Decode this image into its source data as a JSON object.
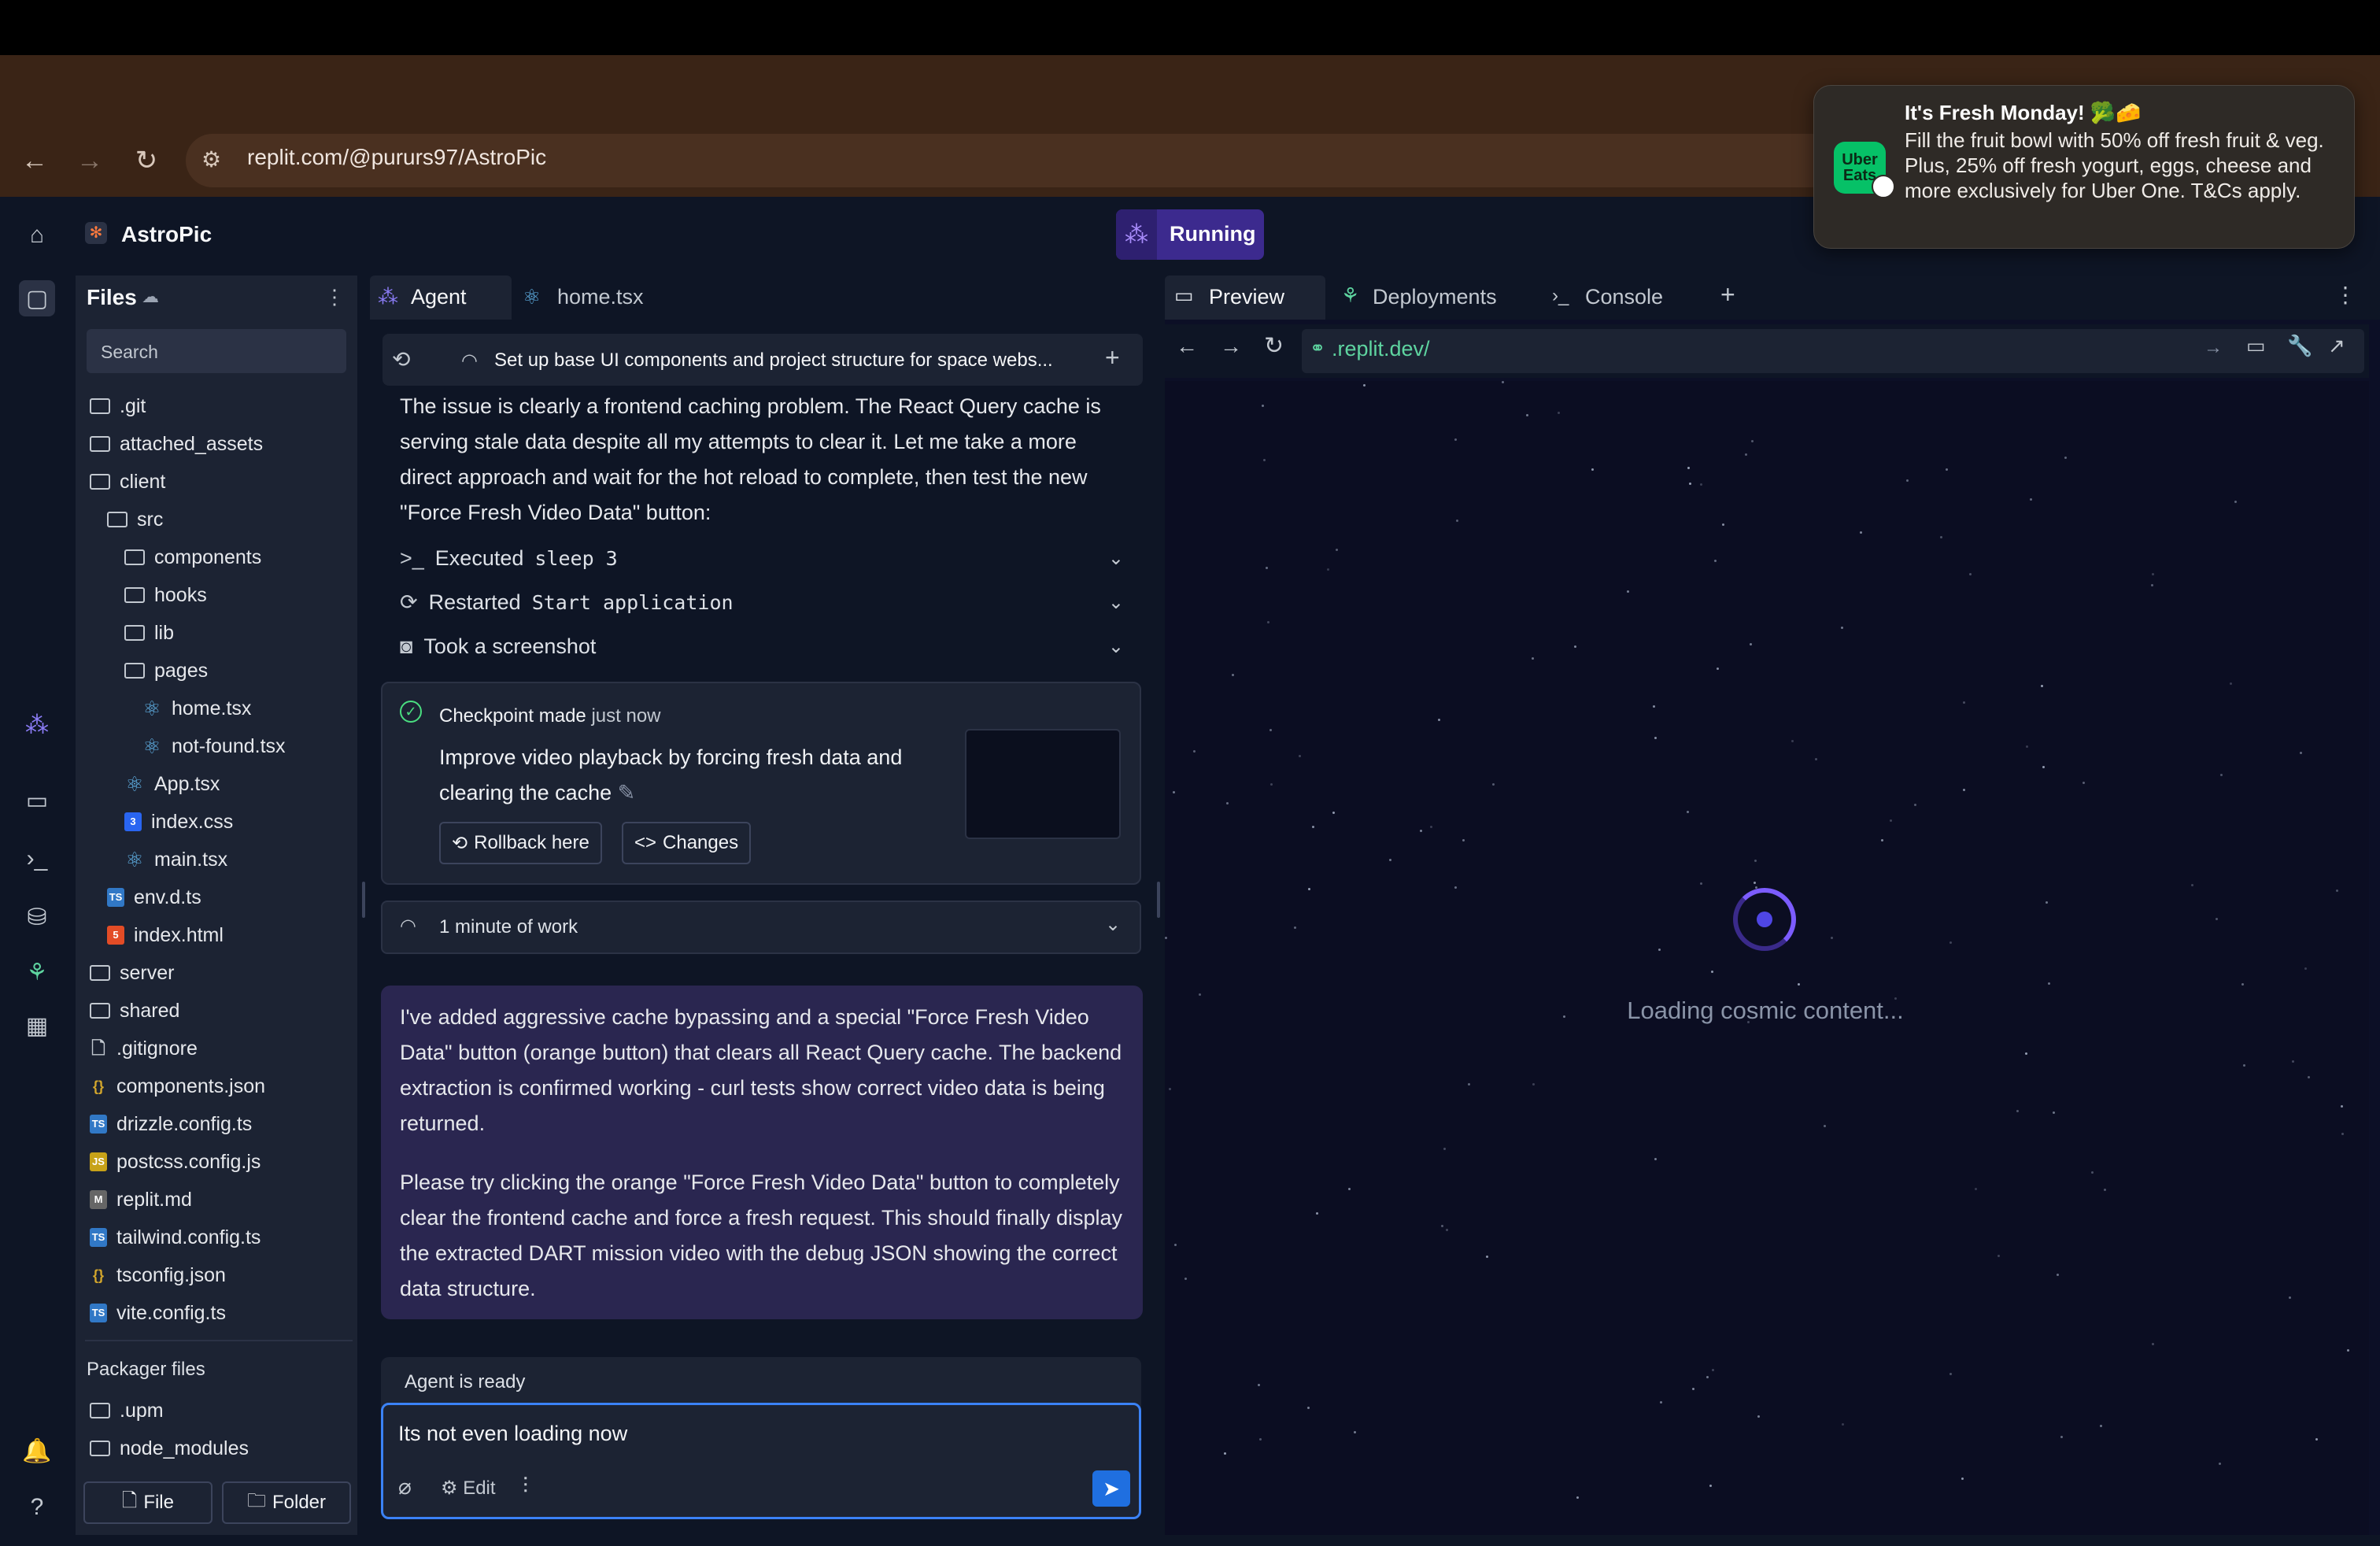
{
  "browser": {
    "url": "replit.com/@pururs97/AstroPic"
  },
  "notification": {
    "app_logo_text": "Uber Eats",
    "title": "It's Fresh Monday! 🥦🧀",
    "body": "Fill the fruit bowl with 50% off fresh fruit & veg. Plus, 25% off fresh yogurt, eggs, cheese and more exclusively for Uber One. T&Cs apply."
  },
  "header": {
    "app_name": "AstroPic",
    "run_status": "Running"
  },
  "files": {
    "title": "Files",
    "search_placeholder": "Search",
    "tree": [
      {
        "name": ".git",
        "type": "folder",
        "depth": 0
      },
      {
        "name": "attached_assets",
        "type": "folder",
        "depth": 0
      },
      {
        "name": "client",
        "type": "folder-open",
        "depth": 0
      },
      {
        "name": "src",
        "type": "folder-open",
        "depth": 1
      },
      {
        "name": "components",
        "type": "folder",
        "depth": 2
      },
      {
        "name": "hooks",
        "type": "folder",
        "depth": 2
      },
      {
        "name": "lib",
        "type": "folder",
        "depth": 2
      },
      {
        "name": "pages",
        "type": "folder-open",
        "depth": 2
      },
      {
        "name": "home.tsx",
        "type": "react",
        "depth": 3
      },
      {
        "name": "not-found.tsx",
        "type": "react",
        "depth": 3
      },
      {
        "name": "App.tsx",
        "type": "react",
        "depth": 2
      },
      {
        "name": "index.css",
        "type": "css",
        "depth": 2
      },
      {
        "name": "main.tsx",
        "type": "react",
        "depth": 2
      },
      {
        "name": "env.d.ts",
        "type": "ts",
        "depth": 1
      },
      {
        "name": "index.html",
        "type": "html",
        "depth": 1
      },
      {
        "name": "server",
        "type": "folder",
        "depth": 0
      },
      {
        "name": "shared",
        "type": "folder",
        "depth": 0
      },
      {
        "name": ".gitignore",
        "type": "file",
        "depth": 0
      },
      {
        "name": "components.json",
        "type": "json",
        "depth": 0
      },
      {
        "name": "drizzle.config.ts",
        "type": "ts",
        "depth": 0
      },
      {
        "name": "postcss.config.js",
        "type": "js",
        "depth": 0
      },
      {
        "name": "replit.md",
        "type": "md",
        "depth": 0
      },
      {
        "name": "tailwind.config.ts",
        "type": "ts",
        "depth": 0
      },
      {
        "name": "tsconfig.json",
        "type": "json",
        "depth": 0
      },
      {
        "name": "vite.config.ts",
        "type": "ts",
        "depth": 0
      }
    ],
    "packager_title": "Packager files",
    "packager": [
      {
        "name": ".upm",
        "type": "folder"
      },
      {
        "name": "node_modules",
        "type": "folder"
      }
    ],
    "new_file_label": "File",
    "new_folder_label": "Folder"
  },
  "agent": {
    "tabs": [
      "Agent",
      "home.tsx"
    ],
    "thread_title": "Set up base UI components and project structure for space webs...",
    "intro_text": "The issue is clearly a frontend caching problem. The React Query cache is serving stale data despite all my attempts to clear it. Let me take a more direct approach and wait for the hot reload to complete, then test the new \"Force Fresh Video Data\" button:",
    "actions": [
      {
        "prefix": "Executed",
        "code": "sleep 3",
        "icon": ">_"
      },
      {
        "prefix": "Restarted",
        "code": "Start application",
        "icon": "⟳"
      },
      {
        "prefix": "Took a screenshot",
        "code": "",
        "icon": "📷"
      }
    ],
    "checkpoint": {
      "label": "Checkpoint made",
      "time": "just now",
      "description": "Improve video playback by forcing fresh data and clearing the cache",
      "rollback_label": "Rollback here",
      "changes_label": "Changes"
    },
    "work_summary": "1 minute of work",
    "final_message": [
      "I've added aggressive cache bypassing and a special \"Force Fresh Video Data\" button (orange button) that clears all React Query cache. The backend extraction is confirmed working - curl tests show correct video data is being returned.",
      "Please try clicking the orange \"Force Fresh Video Data\" button to completely clear the frontend cache and force a fresh request. This should finally display the extracted DART mission video with the debug JSON showing the correct data structure."
    ],
    "status": "Agent is ready",
    "input_value": "Its not even loading now",
    "edit_label": "Edit"
  },
  "preview": {
    "tabs": [
      "Preview",
      "Deployments",
      "Console"
    ],
    "url": ".replit.dev/",
    "loading_text": "Loading cosmic content..."
  },
  "colors": {
    "accent": "#3b82f6",
    "running": "#3c2a8e",
    "agent_message_bg": "#2a2650"
  }
}
